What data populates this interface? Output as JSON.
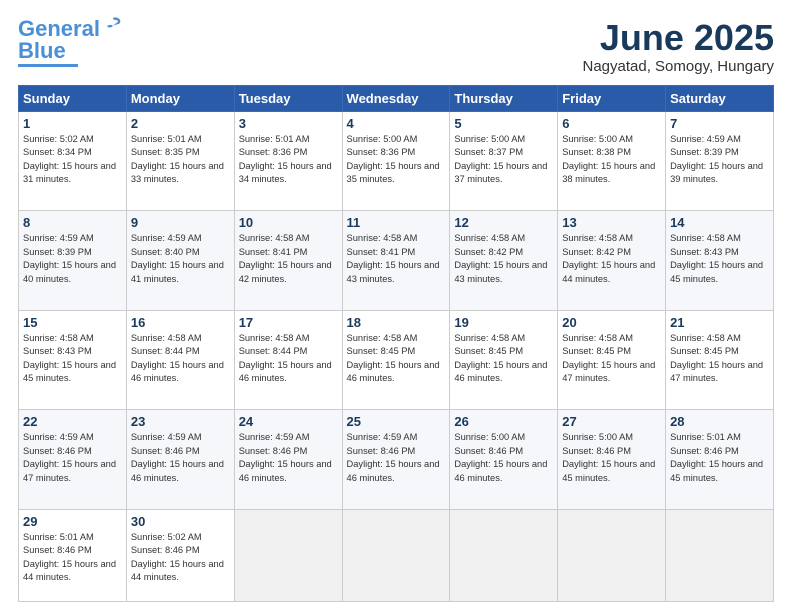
{
  "logo": {
    "line1": "General",
    "line2": "Blue"
  },
  "title": "June 2025",
  "location": "Nagyatad, Somogy, Hungary",
  "days_header": [
    "Sunday",
    "Monday",
    "Tuesday",
    "Wednesday",
    "Thursday",
    "Friday",
    "Saturday"
  ],
  "weeks": [
    [
      {
        "num": "1",
        "sunrise": "5:02 AM",
        "sunset": "8:34 PM",
        "daylight": "15 hours and 31 minutes."
      },
      {
        "num": "2",
        "sunrise": "5:01 AM",
        "sunset": "8:35 PM",
        "daylight": "15 hours and 33 minutes."
      },
      {
        "num": "3",
        "sunrise": "5:01 AM",
        "sunset": "8:36 PM",
        "daylight": "15 hours and 34 minutes."
      },
      {
        "num": "4",
        "sunrise": "5:00 AM",
        "sunset": "8:36 PM",
        "daylight": "15 hours and 35 minutes."
      },
      {
        "num": "5",
        "sunrise": "5:00 AM",
        "sunset": "8:37 PM",
        "daylight": "15 hours and 37 minutes."
      },
      {
        "num": "6",
        "sunrise": "5:00 AM",
        "sunset": "8:38 PM",
        "daylight": "15 hours and 38 minutes."
      },
      {
        "num": "7",
        "sunrise": "4:59 AM",
        "sunset": "8:39 PM",
        "daylight": "15 hours and 39 minutes."
      }
    ],
    [
      {
        "num": "8",
        "sunrise": "4:59 AM",
        "sunset": "8:39 PM",
        "daylight": "15 hours and 40 minutes."
      },
      {
        "num": "9",
        "sunrise": "4:59 AM",
        "sunset": "8:40 PM",
        "daylight": "15 hours and 41 minutes."
      },
      {
        "num": "10",
        "sunrise": "4:58 AM",
        "sunset": "8:41 PM",
        "daylight": "15 hours and 42 minutes."
      },
      {
        "num": "11",
        "sunrise": "4:58 AM",
        "sunset": "8:41 PM",
        "daylight": "15 hours and 43 minutes."
      },
      {
        "num": "12",
        "sunrise": "4:58 AM",
        "sunset": "8:42 PM",
        "daylight": "15 hours and 43 minutes."
      },
      {
        "num": "13",
        "sunrise": "4:58 AM",
        "sunset": "8:42 PM",
        "daylight": "15 hours and 44 minutes."
      },
      {
        "num": "14",
        "sunrise": "4:58 AM",
        "sunset": "8:43 PM",
        "daylight": "15 hours and 45 minutes."
      }
    ],
    [
      {
        "num": "15",
        "sunrise": "4:58 AM",
        "sunset": "8:43 PM",
        "daylight": "15 hours and 45 minutes."
      },
      {
        "num": "16",
        "sunrise": "4:58 AM",
        "sunset": "8:44 PM",
        "daylight": "15 hours and 46 minutes."
      },
      {
        "num": "17",
        "sunrise": "4:58 AM",
        "sunset": "8:44 PM",
        "daylight": "15 hours and 46 minutes."
      },
      {
        "num": "18",
        "sunrise": "4:58 AM",
        "sunset": "8:45 PM",
        "daylight": "15 hours and 46 minutes."
      },
      {
        "num": "19",
        "sunrise": "4:58 AM",
        "sunset": "8:45 PM",
        "daylight": "15 hours and 46 minutes."
      },
      {
        "num": "20",
        "sunrise": "4:58 AM",
        "sunset": "8:45 PM",
        "daylight": "15 hours and 47 minutes."
      },
      {
        "num": "21",
        "sunrise": "4:58 AM",
        "sunset": "8:45 PM",
        "daylight": "15 hours and 47 minutes."
      }
    ],
    [
      {
        "num": "22",
        "sunrise": "4:59 AM",
        "sunset": "8:46 PM",
        "daylight": "15 hours and 47 minutes."
      },
      {
        "num": "23",
        "sunrise": "4:59 AM",
        "sunset": "8:46 PM",
        "daylight": "15 hours and 46 minutes."
      },
      {
        "num": "24",
        "sunrise": "4:59 AM",
        "sunset": "8:46 PM",
        "daylight": "15 hours and 46 minutes."
      },
      {
        "num": "25",
        "sunrise": "4:59 AM",
        "sunset": "8:46 PM",
        "daylight": "15 hours and 46 minutes."
      },
      {
        "num": "26",
        "sunrise": "5:00 AM",
        "sunset": "8:46 PM",
        "daylight": "15 hours and 46 minutes."
      },
      {
        "num": "27",
        "sunrise": "5:00 AM",
        "sunset": "8:46 PM",
        "daylight": "15 hours and 45 minutes."
      },
      {
        "num": "28",
        "sunrise": "5:01 AM",
        "sunset": "8:46 PM",
        "daylight": "15 hours and 45 minutes."
      }
    ],
    [
      {
        "num": "29",
        "sunrise": "5:01 AM",
        "sunset": "8:46 PM",
        "daylight": "15 hours and 44 minutes."
      },
      {
        "num": "30",
        "sunrise": "5:02 AM",
        "sunset": "8:46 PM",
        "daylight": "15 hours and 44 minutes."
      },
      null,
      null,
      null,
      null,
      null
    ]
  ]
}
